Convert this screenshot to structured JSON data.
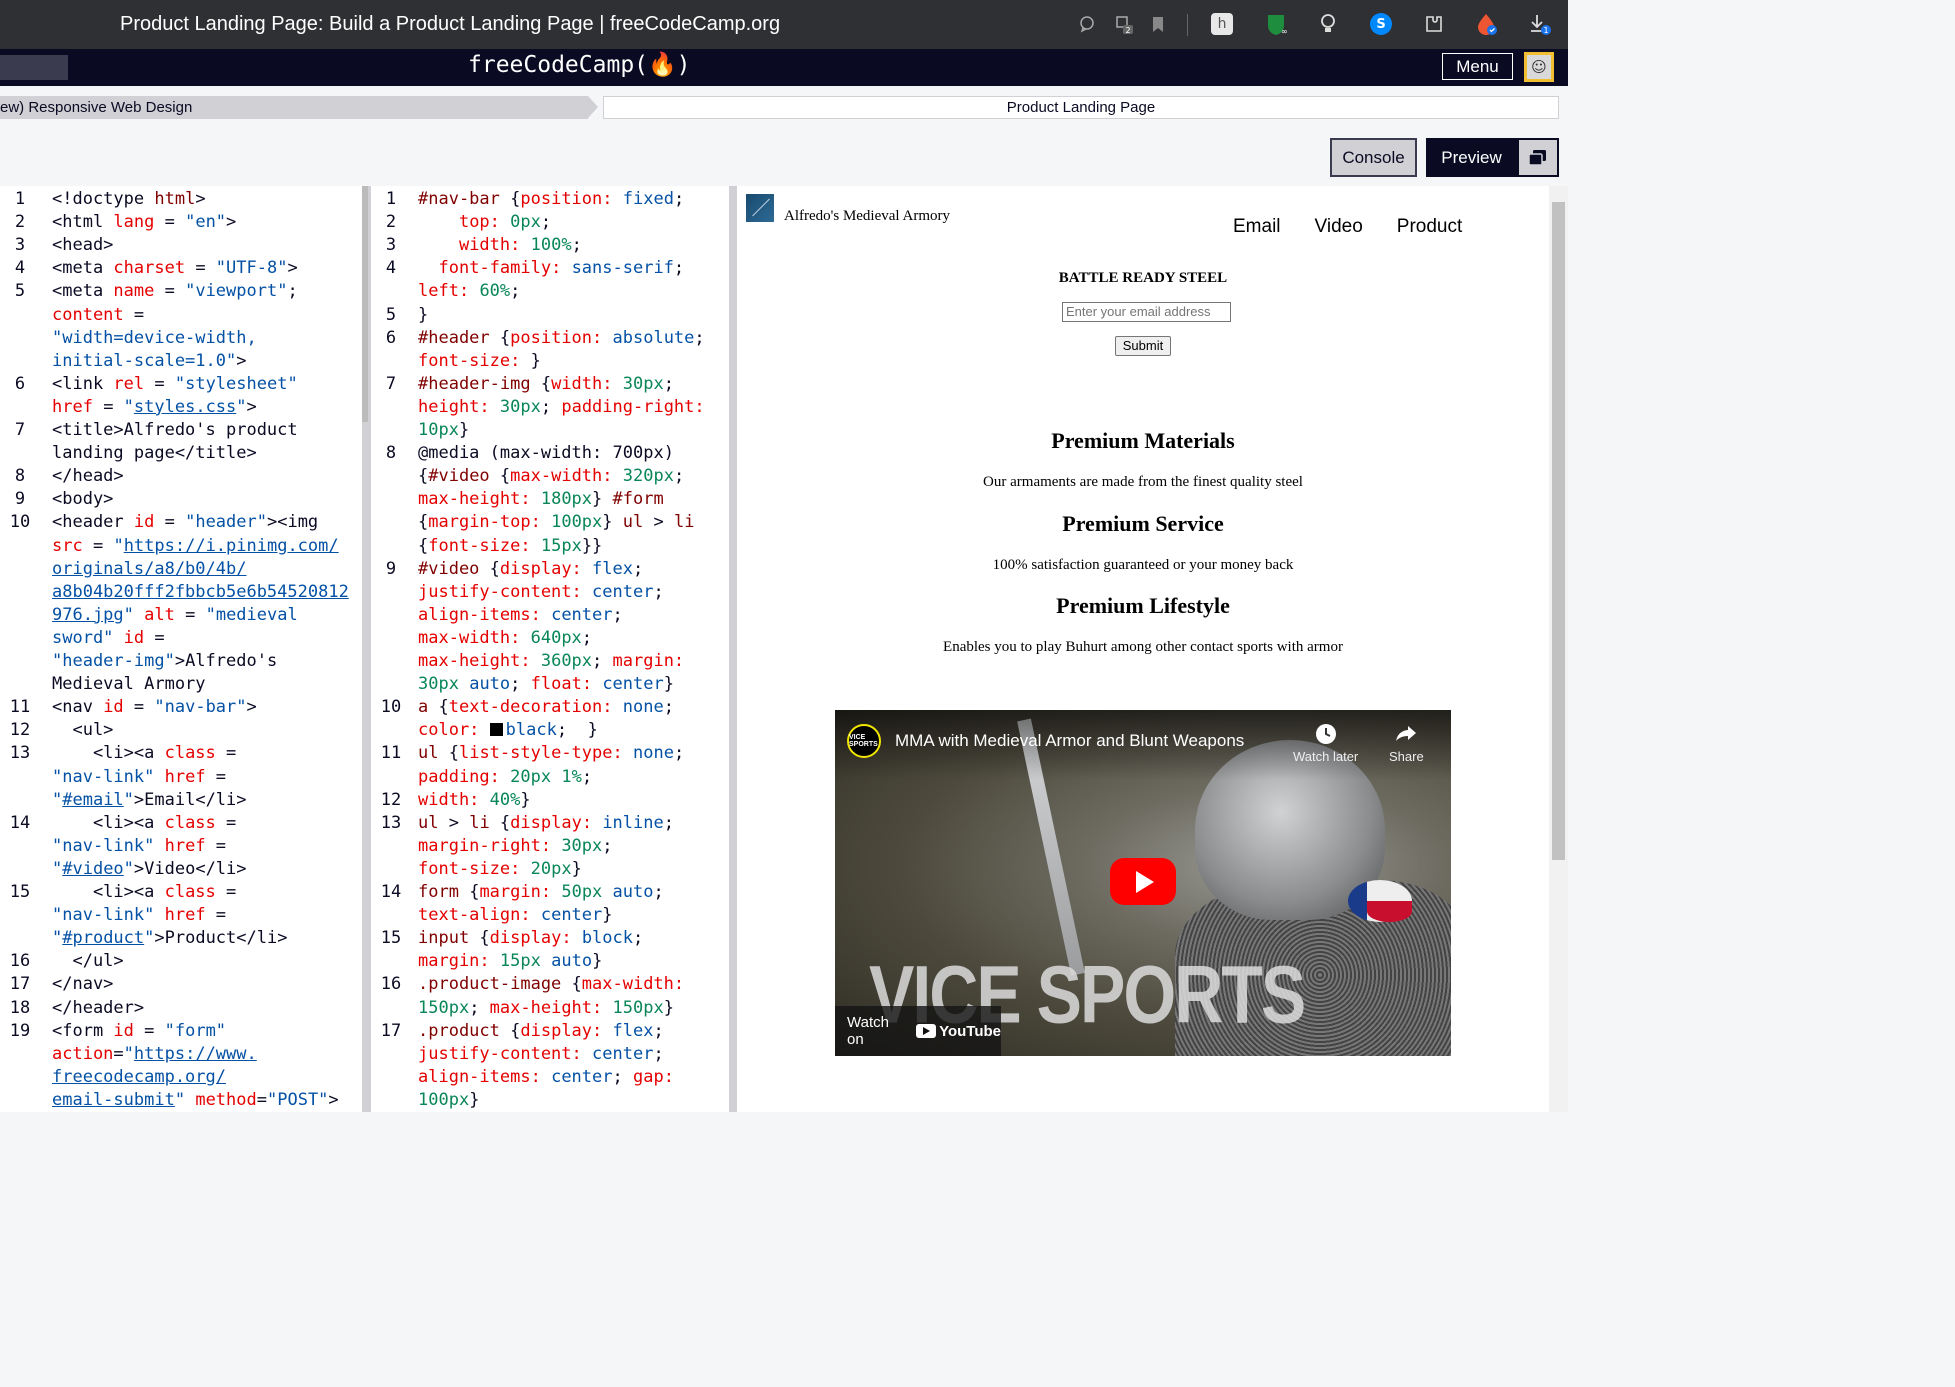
{
  "browser": {
    "title": "Product Landing Page: Build a Product Landing Page | freeCodeCamp.org",
    "download_badge": "1",
    "tabs_badge": "2"
  },
  "fcc_nav": {
    "logo": "freeCodeCamp(🔥)",
    "menu_label": "Menu"
  },
  "breadcrumb": {
    "course": "ew) Responsive Web Design",
    "project": "Product Landing Page"
  },
  "toolbar": {
    "console_label": "Console",
    "preview_label": "Preview"
  },
  "html_editor": {
    "lines": [
      {
        "n": "1",
        "html": "<span class='g'>&lt;!doctype </span><span class='t'>html</span><span class='g'>&gt;</span>"
      },
      {
        "n": "2",
        "html": "&lt;html <span class='a'>lang</span> = <span class='v'>\"en\"</span>&gt;"
      },
      {
        "n": "3",
        "html": "&lt;head&gt;"
      },
      {
        "n": "4",
        "html": "&lt;meta <span class='a'>charset</span> = <span class='v'>\"UTF-8\"</span>&gt;"
      },
      {
        "n": "5",
        "html": "&lt;meta <span class='a'>name</span> = <span class='v'>\"viewport\"</span>;"
      },
      {
        "n": "",
        "html": "<span class='a'>content</span> ="
      },
      {
        "n": "",
        "html": "<span class='v'>\"width=device-width,</span>"
      },
      {
        "n": "",
        "html": "<span class='v'>initial-scale=1.0\"</span>&gt;"
      },
      {
        "n": "6",
        "html": "&lt;link <span class='a'>rel</span> = <span class='v'>\"stylesheet\"</span>"
      },
      {
        "n": "",
        "html": "<span class='a'>href</span> = <span class='v'>\"</span><span class='u'>styles.css</span><span class='v'>\"</span>&gt;"
      },
      {
        "n": "7",
        "html": "&lt;title&gt;Alfredo's product"
      },
      {
        "n": "",
        "html": "landing page&lt;/title&gt;"
      },
      {
        "n": "8",
        "html": "&lt;/head&gt;"
      },
      {
        "n": "9",
        "html": "&lt;body&gt;"
      },
      {
        "n": "10",
        "html": "&lt;header <span class='a'>id</span> = <span class='v'>\"header\"</span>&gt;&lt;img"
      },
      {
        "n": "",
        "html": "<span class='a'>src</span> = <span class='v'>\"</span><span class='u'>https://i.pinimg.com/</span>"
      },
      {
        "n": "",
        "html": "<span class='u'>originals/a8/b0/4b/</span>"
      },
      {
        "n": "",
        "html": "<span class='u'>a8b04b20fff2fbbcb5e6b54520812</span>"
      },
      {
        "n": "",
        "html": "<span class='u'>976.jpg</span><span class='v'>\"</span> <span class='a'>alt</span> = <span class='v'>\"medieval</span>"
      },
      {
        "n": "",
        "html": "<span class='v'>sword\"</span> <span class='a'>id</span> ="
      },
      {
        "n": "",
        "html": "<span class='v'>\"header-img\"</span>&gt;Alfredo's"
      },
      {
        "n": "",
        "html": "Medieval Armory"
      },
      {
        "n": "11",
        "html": "&lt;nav <span class='a'>id</span> = <span class='v'>\"nav-bar\"</span>&gt;"
      },
      {
        "n": "12",
        "html": "  &lt;ul&gt;"
      },
      {
        "n": "13",
        "html": "    &lt;li&gt;&lt;a <span class='a'>class</span> ="
      },
      {
        "n": "",
        "html": "<span class='v'>\"nav-link\"</span> <span class='a'>href</span> ="
      },
      {
        "n": "",
        "html": "<span class='v'>\"</span><span class='u'>#email</span><span class='v'>\"</span>&gt;Email&lt;/li&gt;"
      },
      {
        "n": "14",
        "html": "    &lt;li&gt;&lt;a <span class='a'>class</span> ="
      },
      {
        "n": "",
        "html": "<span class='v'>\"nav-link\"</span> <span class='a'>href</span> ="
      },
      {
        "n": "",
        "html": "<span class='v'>\"</span><span class='u'>#video</span><span class='v'>\"</span>&gt;Video&lt;/li&gt;"
      },
      {
        "n": "15",
        "html": "    &lt;li&gt;&lt;a <span class='a'>class</span> ="
      },
      {
        "n": "",
        "html": "<span class='v'>\"nav-link\"</span> <span class='a'>href</span> ="
      },
      {
        "n": "",
        "html": "<span class='v'>\"</span><span class='u'>#product</span><span class='v'>\"</span>&gt;Product&lt;/li&gt;"
      },
      {
        "n": "16",
        "html": "  &lt;/ul&gt;"
      },
      {
        "n": "17",
        "html": "&lt;/nav&gt;"
      },
      {
        "n": "18",
        "html": "&lt;/header&gt;"
      },
      {
        "n": "19",
        "html": "&lt;form <span class='a'>id</span> = <span class='v'>\"form\"</span>"
      },
      {
        "n": "",
        "html": "<span class='a'>action</span>=<span class='v'>\"</span><span class='u'>https://www.</span>"
      },
      {
        "n": "",
        "html": "<span class='u'>freecodecamp.org/</span>"
      },
      {
        "n": "",
        "html": "<span class='u'>email-submit</span><span class='v'>\"</span> <span class='a'>method</span>=<span class='v'>\"POST\"</span>&gt;"
      }
    ]
  },
  "css_editor": {
    "lines": [
      {
        "n": "1",
        "html": "<span class='p'>#nav-bar</span> {<span class='a'>position:</span> <span class='v'>fixed</span>;"
      },
      {
        "n": "2",
        "html": "    <span class='a'>top:</span> <span class='n'>0px</span>;"
      },
      {
        "n": "3",
        "html": "    <span class='a'>width:</span> <span class='n'>100%</span>;"
      },
      {
        "n": "4",
        "html": "  <span class='a'>font-family:</span> <span class='v'>sans-serif</span>;"
      },
      {
        "n": "",
        "html": "<span class='a'>left:</span> <span class='n'>60%</span>;"
      },
      {
        "n": "5",
        "html": "}"
      },
      {
        "n": "6",
        "html": "<span class='p'>#header</span> {<span class='a'>position:</span> <span class='v'>absolute</span>;"
      },
      {
        "n": "",
        "html": "<span class='a'>font-size:</span> }"
      },
      {
        "n": "7",
        "html": "<span class='p'>#header-img</span> {<span class='a'>width:</span> <span class='n'>30px</span>;"
      },
      {
        "n": "",
        "html": "<span class='a'>height:</span> <span class='n'>30px</span>; <span class='a'>padding-right:</span>"
      },
      {
        "n": "",
        "html": "<span class='n'>10px</span>}"
      },
      {
        "n": "8",
        "html": "@media (<span class='g'>max-width:</span> <span class='g'>700px</span>)"
      },
      {
        "n": "",
        "html": "{<span class='p'>#video</span> {<span class='a'>max-width:</span> <span class='n'>320px</span>;"
      },
      {
        "n": "",
        "html": "<span class='a'>max-height:</span> <span class='n'>180px</span>} <span class='p'>#form</span>"
      },
      {
        "n": "",
        "html": "{<span class='a'>margin-top:</span> <span class='n'>100px</span>} <span class='p'>ul</span> &gt; <span class='p'>li</span>"
      },
      {
        "n": "",
        "html": "{<span class='a'>font-size:</span> <span class='n'>15px</span>}}"
      },
      {
        "n": "9",
        "html": "<span class='p'>#video</span> {<span class='a'>display:</span> <span class='v'>flex</span>;"
      },
      {
        "n": "",
        "html": "<span class='a'>justify-content:</span> <span class='v'>center</span>;"
      },
      {
        "n": "",
        "html": "<span class='a'>align-items:</span> <span class='v'>center</span>;"
      },
      {
        "n": "",
        "html": "<span class='a'>max-width:</span> <span class='n'>640px</span>;"
      },
      {
        "n": "",
        "html": "<span class='a'>max-height:</span> <span class='n'>360px</span>; <span class='a'>margin:</span>"
      },
      {
        "n": "",
        "html": "<span class='n'>30px</span> <span class='v'>auto</span>; <span class='a'>float:</span> <span class='v'>center</span>}"
      },
      {
        "n": "10",
        "html": "<span class='p'>a</span> {<span class='a'>text-decoration:</span> <span class='v'>none</span>;"
      },
      {
        "n": "",
        "html": "<span class='a'>color:</span> <span class='bl'></span><span class='v'>black</span>;  }"
      },
      {
        "n": "11",
        "html": "<span class='p'>ul</span> {<span class='a'>list-style-type:</span> <span class='v'>none</span>;"
      },
      {
        "n": "",
        "html": "<span class='a'>padding:</span> <span class='n'>20px</span> <span class='n'>1%</span>;"
      },
      {
        "n": "12",
        "html": "<span class='a'>width:</span> <span class='n'>40%</span>}"
      },
      {
        "n": "13",
        "html": "<span class='p'>ul</span> &gt; <span class='p'>li</span> {<span class='a'>display:</span> <span class='v'>inline</span>;"
      },
      {
        "n": "",
        "html": "<span class='a'>margin-right:</span> <span class='n'>30px</span>;"
      },
      {
        "n": "",
        "html": "<span class='a'>font-size:</span> <span class='n'>20px</span>}"
      },
      {
        "n": "14",
        "html": "<span class='p'>form</span> {<span class='a'>margin:</span> <span class='n'>50px</span> <span class='v'>auto</span>;"
      },
      {
        "n": "",
        "html": "<span class='a'>text-align:</span> <span class='v'>center</span>}"
      },
      {
        "n": "15",
        "html": "<span class='p'>input</span> {<span class='a'>display:</span> <span class='v'>block</span>;"
      },
      {
        "n": "",
        "html": "<span class='a'>margin:</span> <span class='n'>15px</span> <span class='v'>auto</span>}"
      },
      {
        "n": "16",
        "html": "<span class='p'>.product-image</span> {<span class='a'>max-width:</span>"
      },
      {
        "n": "",
        "html": "<span class='n'>150px</span>; <span class='a'>max-height:</span> <span class='n'>150px</span>}"
      },
      {
        "n": "17",
        "html": "<span class='p'>.product</span> {<span class='a'>display:</span> <span class='v'>flex</span>;"
      },
      {
        "n": "",
        "html": "<span class='a'>justify-content:</span> <span class='v'>center</span>;"
      },
      {
        "n": "",
        "html": "<span class='a'>align-items:</span> <span class='v'>center</span>; <span class='a'>gap:</span>"
      },
      {
        "n": "",
        "html": "<span class='n'>100px</span>}"
      }
    ]
  },
  "preview": {
    "brand": "Alfredo's Medieval Armory",
    "nav": [
      "Email",
      "Video",
      "Product"
    ],
    "hero_title": "BATTLE READY STEEL",
    "email_placeholder": "Enter your email address",
    "submit_label": "Submit",
    "features": [
      {
        "title": "Premium Materials",
        "text": "Our armaments are made from the finest quality steel"
      },
      {
        "title": "Premium Service",
        "text": "100% satisfaction guaranteed or your money back"
      },
      {
        "title": "Premium Lifestyle",
        "text": "Enables you to play Buhurt among other contact sports with armor"
      }
    ],
    "video": {
      "title": "MMA with Medieval Armor and Blunt Weapons",
      "channel": "VICE SPORTS",
      "watch_later": "Watch later",
      "share": "Share",
      "watch_on": "Watch on",
      "youtube": "YouTube",
      "watermark": "VICE SPORTS"
    }
  }
}
